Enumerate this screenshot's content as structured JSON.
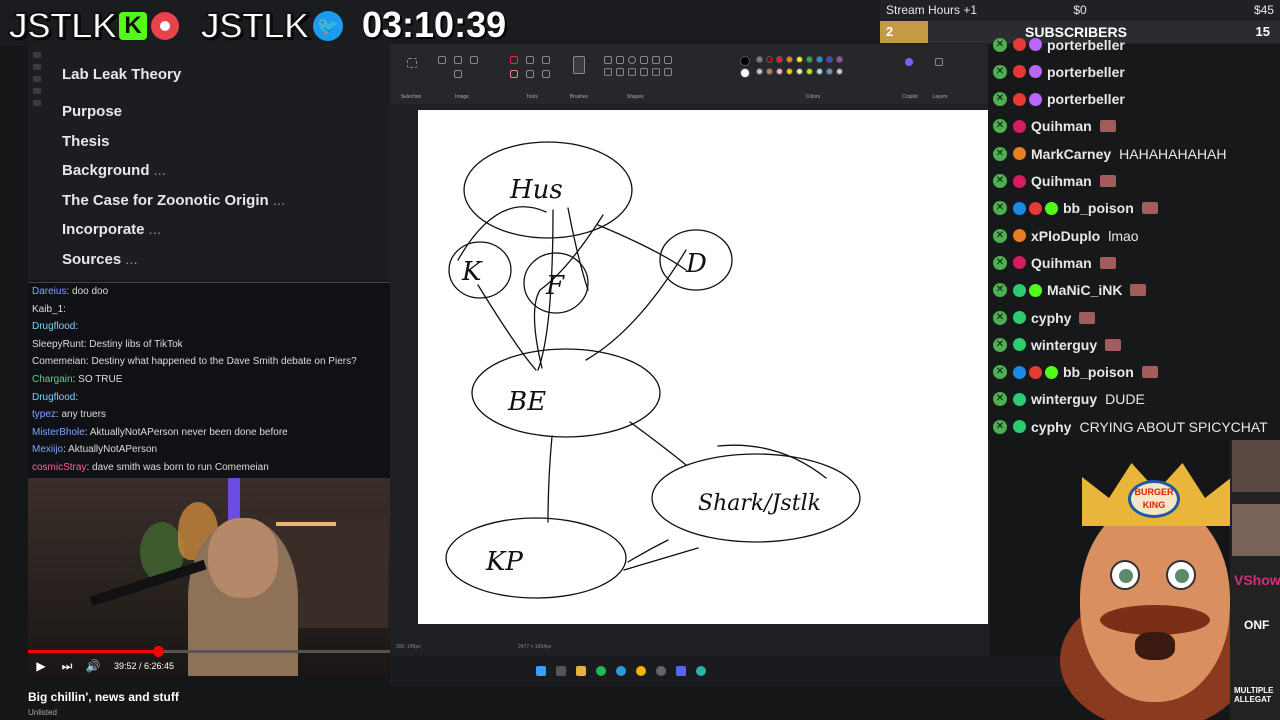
{
  "overlay": {
    "logo1": "JSTLK",
    "badge_k": "K",
    "logo2": "JSTLK",
    "tw_glyph": "🐦",
    "timer": "03:10:39"
  },
  "stream_stats": {
    "label": "Stream Hours +1",
    "money1": "$0",
    "money2": "$45",
    "sub_count": "2",
    "sub_label": "SUBSCRIBERS",
    "sub_goal": "15"
  },
  "outline": {
    "title": "Lab Leak Theory",
    "items": [
      {
        "label": "Purpose",
        "more": ""
      },
      {
        "label": "Thesis",
        "more": ""
      },
      {
        "label": "Background",
        "more": "..."
      },
      {
        "label": "The Case for Zoonotic Origin",
        "more": "..."
      },
      {
        "label": "Incorporate",
        "more": "..."
      },
      {
        "label": "Sources",
        "more": "..."
      }
    ]
  },
  "left_chat": [
    {
      "user": "Dareius",
      "color": "#7fa3ff",
      "text": ": doo doo"
    },
    {
      "user": "Kaib_1",
      "color": "#dddddd",
      "text": ":"
    },
    {
      "user": "Drugflood",
      "color": "#7fd1ff",
      "text": ":"
    },
    {
      "user": "SleepyRunt",
      "color": "#dddddd",
      "text": ": Destiny libs of TikTok"
    },
    {
      "user": "Comemeian",
      "color": "#dddddd",
      "text": ": Destiny what happened to the Dave Smith debate on Piers?"
    },
    {
      "user": "Chargain",
      "color": "#58d68d",
      "text": ": SO TRUE"
    },
    {
      "user": "Drugflood",
      "color": "#7fd1ff",
      "text": ":"
    },
    {
      "user": "typez",
      "color": "#7fa3ff",
      "text": ": any truers"
    },
    {
      "user": "MisterBhole",
      "color": "#7fa3ff",
      "text": ": AktuallyNotAPerson      never been done before"
    },
    {
      "user": "Mexiijo",
      "color": "#7fa3ff",
      "text": ": AktuallyNotAPerson"
    },
    {
      "user": "cosmicStray",
      "color": "#ff5fa2",
      "text": ": dave smith was born to run Comemeian"
    }
  ],
  "video": {
    "time": "39:52 / 6:26:45",
    "progress": 0.36,
    "play_glyph": "▶",
    "next_glyph": "⏭",
    "vol_glyph": "🔊",
    "title": "Big chillin', news and stuff",
    "visibility": "Unlisted"
  },
  "paint": {
    "groups": [
      "Selection",
      "Image",
      "Tools",
      "Brushes",
      "Shapes",
      "Colors",
      "Copilot",
      "Layers"
    ],
    "status_left": "390, 145px",
    "status_mid": "2477 × 1654px",
    "nodes": [
      "Hus",
      "K",
      "F",
      "D",
      "BE",
      "Shark/Jstlk",
      "KP"
    ],
    "swatches": [
      "#000000",
      "#7f7f7f",
      "#880015",
      "#ed1c24",
      "#ff7f27",
      "#fff200",
      "#22b14c",
      "#00a2e8",
      "#3f48cc",
      "#a349a4",
      "#ffffff",
      "#c3c3c3",
      "#b97a57",
      "#ffaec9",
      "#ffc90e",
      "#efe4b0",
      "#b5e61d",
      "#99d9ea",
      "#7092be",
      "#c8bfe7"
    ]
  },
  "right_chat": [
    {
      "user": "porterbeller",
      "badges": [
        "#e53935",
        "#b967ff"
      ],
      "msg": "",
      "emote": false
    },
    {
      "user": "porterbeller",
      "badges": [
        "#e53935",
        "#b967ff"
      ],
      "msg": "",
      "emote": false
    },
    {
      "user": "porterbeller",
      "badges": [
        "#e53935",
        "#b967ff"
      ],
      "msg": "",
      "emote": false
    },
    {
      "user": "Quihman",
      "badges": [
        "#d81b60"
      ],
      "msg": "",
      "emote": true
    },
    {
      "user": "MarkCarney",
      "badges": [
        "#e67e22"
      ],
      "msg": "HAHAHAHAHAH",
      "emote": false
    },
    {
      "user": "Quihman",
      "badges": [
        "#d81b60"
      ],
      "msg": "",
      "emote": true
    },
    {
      "user": "bb_poison",
      "badges": [
        "#1e88e5",
        "#e53935",
        "#53fc18"
      ],
      "msg": "",
      "emote": true
    },
    {
      "user": "xPloDuplo",
      "badges": [
        "#e67e22"
      ],
      "msg": "lmao",
      "emote": false
    },
    {
      "user": "Quihman",
      "badges": [
        "#d81b60"
      ],
      "msg": "",
      "emote": true
    },
    {
      "user": "MaNiC_iNK",
      "badges": [
        "#2ecc71",
        "#53fc18"
      ],
      "msg": "",
      "emote": true
    },
    {
      "user": "cyphy",
      "badges": [
        "#2ecc71"
      ],
      "msg": "",
      "emote": true
    },
    {
      "user": "winterguy",
      "badges": [
        "#2ecc71"
      ],
      "msg": "",
      "emote": true
    },
    {
      "user": "bb_poison",
      "badges": [
        "#1e88e5",
        "#e53935",
        "#53fc18"
      ],
      "msg": "",
      "emote": true
    },
    {
      "user": "winterguy",
      "badges": [
        "#2ecc71"
      ],
      "msg": "DUDE",
      "emote": false
    },
    {
      "user": "cyphy",
      "badges": [
        "#2ecc71"
      ],
      "msg": "CRYING ABOUT SPICYCHAT",
      "emote": false
    }
  ],
  "mascot": {
    "logo": "BURGER KING"
  },
  "side_thumbs": {
    "vshow": "VShow",
    "conf": "ONF",
    "multiple": "MULTIPLE ALLEGAT"
  }
}
